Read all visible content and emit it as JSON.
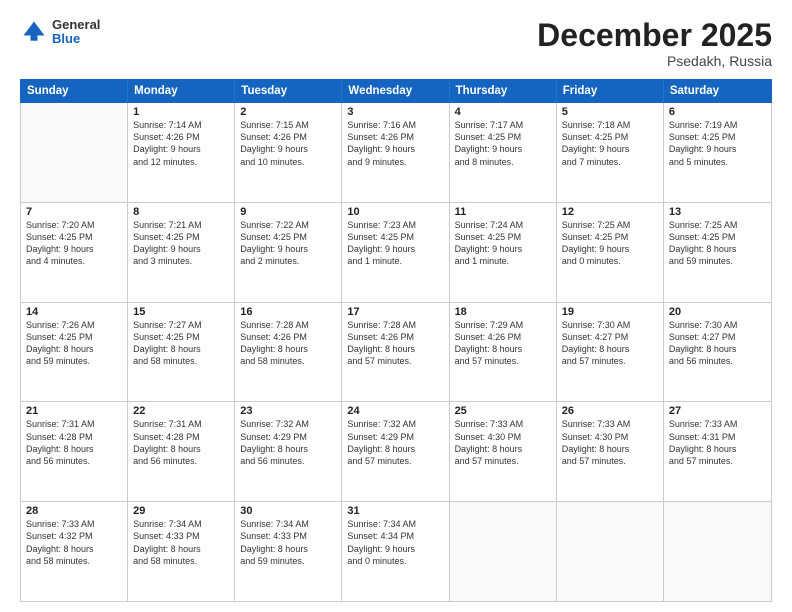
{
  "header": {
    "logo": {
      "general": "General",
      "blue": "Blue"
    },
    "title": "December 2025",
    "location": "Psedakh, Russia"
  },
  "calendar": {
    "days": [
      "Sunday",
      "Monday",
      "Tuesday",
      "Wednesday",
      "Thursday",
      "Friday",
      "Saturday"
    ],
    "rows": [
      [
        {
          "date": "",
          "info": ""
        },
        {
          "date": "1",
          "info": "Sunrise: 7:14 AM\nSunset: 4:26 PM\nDaylight: 9 hours\nand 12 minutes."
        },
        {
          "date": "2",
          "info": "Sunrise: 7:15 AM\nSunset: 4:26 PM\nDaylight: 9 hours\nand 10 minutes."
        },
        {
          "date": "3",
          "info": "Sunrise: 7:16 AM\nSunset: 4:26 PM\nDaylight: 9 hours\nand 9 minutes."
        },
        {
          "date": "4",
          "info": "Sunrise: 7:17 AM\nSunset: 4:25 PM\nDaylight: 9 hours\nand 8 minutes."
        },
        {
          "date": "5",
          "info": "Sunrise: 7:18 AM\nSunset: 4:25 PM\nDaylight: 9 hours\nand 7 minutes."
        },
        {
          "date": "6",
          "info": "Sunrise: 7:19 AM\nSunset: 4:25 PM\nDaylight: 9 hours\nand 5 minutes."
        }
      ],
      [
        {
          "date": "7",
          "info": "Sunrise: 7:20 AM\nSunset: 4:25 PM\nDaylight: 9 hours\nand 4 minutes."
        },
        {
          "date": "8",
          "info": "Sunrise: 7:21 AM\nSunset: 4:25 PM\nDaylight: 9 hours\nand 3 minutes."
        },
        {
          "date": "9",
          "info": "Sunrise: 7:22 AM\nSunset: 4:25 PM\nDaylight: 9 hours\nand 2 minutes."
        },
        {
          "date": "10",
          "info": "Sunrise: 7:23 AM\nSunset: 4:25 PM\nDaylight: 9 hours\nand 1 minute."
        },
        {
          "date": "11",
          "info": "Sunrise: 7:24 AM\nSunset: 4:25 PM\nDaylight: 9 hours\nand 1 minute."
        },
        {
          "date": "12",
          "info": "Sunrise: 7:25 AM\nSunset: 4:25 PM\nDaylight: 9 hours\nand 0 minutes."
        },
        {
          "date": "13",
          "info": "Sunrise: 7:25 AM\nSunset: 4:25 PM\nDaylight: 8 hours\nand 59 minutes."
        }
      ],
      [
        {
          "date": "14",
          "info": "Sunrise: 7:26 AM\nSunset: 4:25 PM\nDaylight: 8 hours\nand 59 minutes."
        },
        {
          "date": "15",
          "info": "Sunrise: 7:27 AM\nSunset: 4:25 PM\nDaylight: 8 hours\nand 58 minutes."
        },
        {
          "date": "16",
          "info": "Sunrise: 7:28 AM\nSunset: 4:26 PM\nDaylight: 8 hours\nand 58 minutes."
        },
        {
          "date": "17",
          "info": "Sunrise: 7:28 AM\nSunset: 4:26 PM\nDaylight: 8 hours\nand 57 minutes."
        },
        {
          "date": "18",
          "info": "Sunrise: 7:29 AM\nSunset: 4:26 PM\nDaylight: 8 hours\nand 57 minutes."
        },
        {
          "date": "19",
          "info": "Sunrise: 7:30 AM\nSunset: 4:27 PM\nDaylight: 8 hours\nand 57 minutes."
        },
        {
          "date": "20",
          "info": "Sunrise: 7:30 AM\nSunset: 4:27 PM\nDaylight: 8 hours\nand 56 minutes."
        }
      ],
      [
        {
          "date": "21",
          "info": "Sunrise: 7:31 AM\nSunset: 4:28 PM\nDaylight: 8 hours\nand 56 minutes."
        },
        {
          "date": "22",
          "info": "Sunrise: 7:31 AM\nSunset: 4:28 PM\nDaylight: 8 hours\nand 56 minutes."
        },
        {
          "date": "23",
          "info": "Sunrise: 7:32 AM\nSunset: 4:29 PM\nDaylight: 8 hours\nand 56 minutes."
        },
        {
          "date": "24",
          "info": "Sunrise: 7:32 AM\nSunset: 4:29 PM\nDaylight: 8 hours\nand 57 minutes."
        },
        {
          "date": "25",
          "info": "Sunrise: 7:33 AM\nSunset: 4:30 PM\nDaylight: 8 hours\nand 57 minutes."
        },
        {
          "date": "26",
          "info": "Sunrise: 7:33 AM\nSunset: 4:30 PM\nDaylight: 8 hours\nand 57 minutes."
        },
        {
          "date": "27",
          "info": "Sunrise: 7:33 AM\nSunset: 4:31 PM\nDaylight: 8 hours\nand 57 minutes."
        }
      ],
      [
        {
          "date": "28",
          "info": "Sunrise: 7:33 AM\nSunset: 4:32 PM\nDaylight: 8 hours\nand 58 minutes."
        },
        {
          "date": "29",
          "info": "Sunrise: 7:34 AM\nSunset: 4:33 PM\nDaylight: 8 hours\nand 58 minutes."
        },
        {
          "date": "30",
          "info": "Sunrise: 7:34 AM\nSunset: 4:33 PM\nDaylight: 8 hours\nand 59 minutes."
        },
        {
          "date": "31",
          "info": "Sunrise: 7:34 AM\nSunset: 4:34 PM\nDaylight: 9 hours\nand 0 minutes."
        },
        {
          "date": "",
          "info": ""
        },
        {
          "date": "",
          "info": ""
        },
        {
          "date": "",
          "info": ""
        }
      ]
    ]
  }
}
